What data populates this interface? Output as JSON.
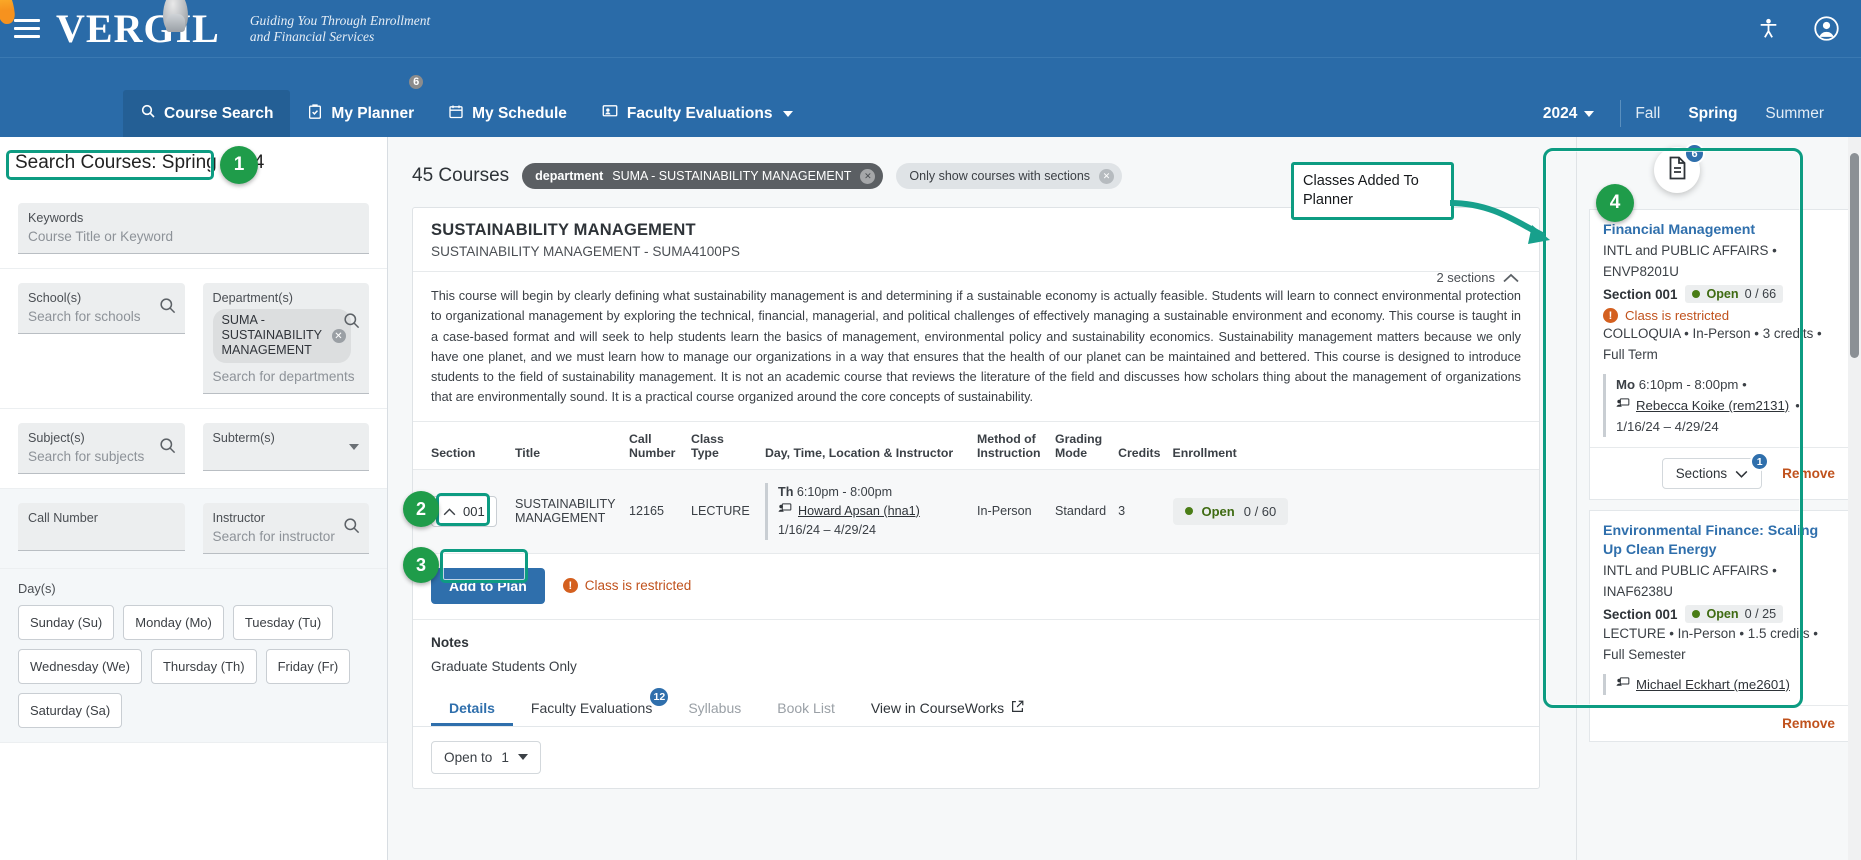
{
  "brand": {
    "logo_text": "VERGIL",
    "tagline_line1": "Guiding You Through Enrollment",
    "tagline_line2": "and Financial Services",
    "menu_icon": "hamburger-icon",
    "accessibility_icon": "accessibility-icon",
    "account_icon": "user-account-icon"
  },
  "nav": {
    "items": [
      {
        "label": "Course Search",
        "icon": "search-icon",
        "active": true,
        "badge": ""
      },
      {
        "label": "My Planner",
        "icon": "clipboard-check-icon",
        "active": false,
        "badge": "6"
      },
      {
        "label": "My Schedule",
        "icon": "calendar-icon",
        "active": false,
        "badge": ""
      },
      {
        "label": "Faculty Evaluations",
        "icon": "person-board-icon",
        "active": false,
        "badge": "",
        "caret": true
      }
    ],
    "year": "2024",
    "terms": [
      {
        "label": "Fall",
        "selected": false
      },
      {
        "label": "Spring",
        "selected": true
      },
      {
        "label": "Summer",
        "selected": false
      }
    ]
  },
  "left": {
    "search_title": "Search Courses: Spring 2024",
    "keywords": {
      "label": "Keywords",
      "placeholder": "Course Title or Keyword",
      "value": ""
    },
    "schools": {
      "label": "School(s)",
      "placeholder": "Search for schools",
      "icon": "search-icon"
    },
    "departments": {
      "label": "Department(s)",
      "placeholder": "Search for departments",
      "icon": "search-icon",
      "chips": [
        "SUMA - SUSTAINABILITY MANAGEMENT"
      ]
    },
    "subjects": {
      "label": "Subject(s)",
      "placeholder": "Search for subjects",
      "icon": "search-icon"
    },
    "subterms": {
      "label": "Subterm(s)",
      "placeholder": "",
      "icon": "chevron-down-icon"
    },
    "call_number": {
      "label": "Call Number",
      "placeholder": "",
      "value": ""
    },
    "instructor": {
      "label": "Instructor",
      "placeholder": "Search for instructor",
      "icon": "search-icon"
    },
    "days": {
      "label": "Day(s)",
      "options": [
        "Sunday (Su)",
        "Monday (Mo)",
        "Tuesday (Tu)",
        "Wednesday (We)",
        "Thursday (Th)",
        "Friday (Fr)",
        "Saturday (Sa)"
      ]
    }
  },
  "center": {
    "results_count": "45 Courses",
    "filter_pills": [
      {
        "key": "department",
        "value": "SUMA - SUSTAINABILITY MANAGEMENT",
        "style": "dark"
      },
      {
        "key": "",
        "value": "Only show courses with sections",
        "style": "light"
      }
    ],
    "course": {
      "title": "SUSTAINABILITY MANAGEMENT",
      "subtitle": "SUSTAINABILITY MANAGEMENT - SUMA4100PS",
      "sections_count": "2 sections",
      "collapse_icon": "chevron-up-icon",
      "description": "This course will begin by clearly defining what sustainability management is and determining if a sustainable economy is actually feasible. Students will learn to connect environmental protection to organizational management by exploring the technical, financial, managerial, and political challenges of effectively managing a sustainable environment and economy. This course is taught in a case-based format and will seek to help students learn the basics of management, environmental policy and sustainability economics. Sustainability management matters because we only have one planet, and we must learn how to manage our organizations in a way that ensures that the health of our planet can be maintained and bettered. This course is designed to introduce students to the field of sustainability management. It is not an academic course that reviews the literature of the field and discusses how scholars thing about the management of organizations that are environmentally sound. It is a practical course organized around the core concepts of sustainability."
    },
    "table": {
      "headers": [
        "Section",
        "Title",
        "Call Number",
        "Class Type",
        "Day, Time, Location & Instructor",
        "Method of Instruction",
        "Grading Mode",
        "Credits",
        "Enrollment"
      ],
      "rows": [
        {
          "section": "001",
          "section_icon": "chevron-up-icon",
          "title": "SUSTAINABILITY MANAGEMENT",
          "call_number": "12165",
          "class_type": "LECTURE",
          "meeting_days": "Th",
          "meeting_time": "6:10pm - 8:00pm",
          "instructor": "Howard Apsan (hna1)",
          "instructor_icon": "presenter-icon",
          "date_range": "1/16/24 – 4/29/24",
          "method": "In-Person",
          "grading": "Standard",
          "credits": "3",
          "enrollment_status": "Open",
          "enrollment_count": "0 / 60"
        }
      ]
    },
    "add_to_plan_label": "Add to Plan",
    "restricted_text": "Class is restricted",
    "restricted_icon": "info-exclamation-icon",
    "notes_heading": "Notes",
    "notes_body": "Graduate Students Only",
    "tabs": [
      {
        "label": "Details",
        "active": true,
        "badge": "",
        "dim": false
      },
      {
        "label": "Faculty Evaluations",
        "active": false,
        "badge": "12",
        "dim": false
      },
      {
        "label": "Syllabus",
        "active": false,
        "badge": "",
        "dim": true
      },
      {
        "label": "Book List",
        "active": false,
        "badge": "",
        "dim": true
      },
      {
        "label": "View in CourseWorks",
        "active": false,
        "badge": "",
        "dim": false,
        "external": true,
        "icon": "external-link-icon"
      }
    ],
    "open_to": {
      "label": "Open to",
      "value": "1",
      "icon": "chevron-down-icon"
    }
  },
  "planner": {
    "doc_icon": "document-icon",
    "doc_badge": "6",
    "cards": [
      {
        "title": "Financial Management",
        "department": "INTL and PUBLIC AFFAIRS •",
        "code": "ENVP8201U",
        "section_label": "Section 001",
        "enrollment_status": "Open",
        "enrollment_count": "0 / 66",
        "restricted": "Class is restricted",
        "restricted_icon": "info-exclamation-icon",
        "attributes": "COLLOQUIA • In-Person • 3 credits •",
        "term": "Full Term",
        "meeting_days": "Mo",
        "meeting_time": "6:10pm - 8:00pm •",
        "instructor": "Rebecca Koike (rem2131)",
        "instructor_icon": "presenter-icon",
        "instructor_suffix": "•",
        "date_range": "1/16/24 – 4/29/24",
        "sections_label": "Sections",
        "sections_badge": "1",
        "sections_icon": "chevron-down-icon",
        "remove_label": "Remove"
      },
      {
        "title": "Environmental Finance: Scaling Up Clean Energy",
        "department": "INTL and PUBLIC AFFAIRS •",
        "code": "INAF6238U",
        "section_label": "Section 001",
        "enrollment_status": "Open",
        "enrollment_count": "0 / 25",
        "restricted": "",
        "attributes": "LECTURE • In-Person • 1.5 credits •",
        "term": "Full Semester",
        "meeting_days": "",
        "meeting_time": "",
        "instructor": "Michael Eckhart (me2601)",
        "instructor_icon": "presenter-icon",
        "instructor_suffix": "",
        "date_range": "",
        "sections_label": "Sections",
        "sections_badge": "",
        "sections_icon": "chevron-down-icon",
        "remove_label": "Remove"
      }
    ]
  },
  "annotations": {
    "callout_label": "Classes Added To Planner",
    "markers": [
      {
        "number": "1"
      },
      {
        "number": "2"
      },
      {
        "number": "3"
      },
      {
        "number": "4"
      }
    ],
    "highlight_color": "#0d9c82",
    "marker_color": "#1f9c4a"
  }
}
